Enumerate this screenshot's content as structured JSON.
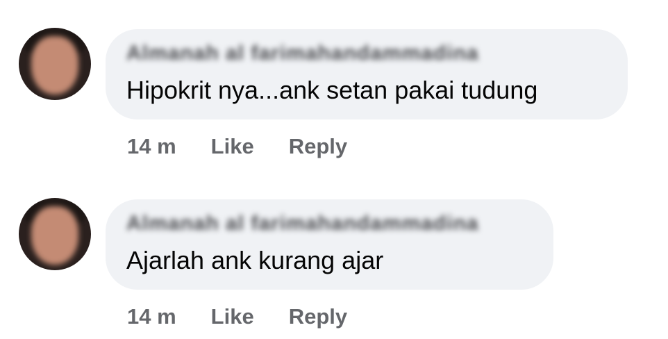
{
  "comments": [
    {
      "author": "Almanah al farimahandammadina",
      "text": "Hipokrit nya...ank setan pakai tudung",
      "time": "14 m",
      "like_label": "Like",
      "reply_label": "Reply"
    },
    {
      "author": "Almanah al farimahandammadina",
      "text": "Ajarlah ank kurang ajar",
      "time": "14 m",
      "like_label": "Like",
      "reply_label": "Reply"
    }
  ],
  "colors": {
    "bubble_background": "#f0f2f5",
    "comment_text": "#050505",
    "meta_text": "#65676b"
  }
}
